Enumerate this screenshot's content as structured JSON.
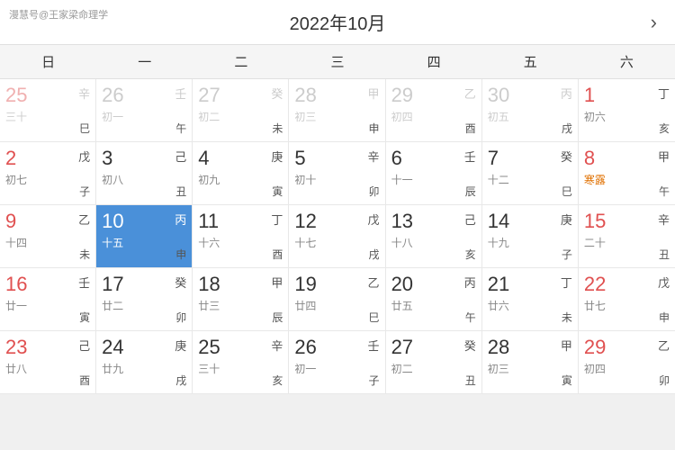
{
  "header": {
    "title": "2022年10月",
    "nav_next": "›",
    "watermark": "漫慧号@王家梁命理学"
  },
  "weekdays": [
    "日",
    "一",
    "二",
    "三",
    "四",
    "五",
    "六"
  ],
  "weeks": [
    [
      {
        "day": "25",
        "lunar": "三十",
        "heavenly": "辛",
        "earthly": "巳",
        "otherMonth": true,
        "weekend": true
      },
      {
        "day": "26",
        "lunar": "初一",
        "heavenly": "壬",
        "earthly": "午",
        "otherMonth": true,
        "weekend": false
      },
      {
        "day": "27",
        "lunar": "初二",
        "heavenly": "癸",
        "earthly": "未",
        "otherMonth": true,
        "weekend": false
      },
      {
        "day": "28",
        "lunar": "初三",
        "heavenly": "甲",
        "earthly": "申",
        "otherMonth": true,
        "weekend": false
      },
      {
        "day": "29",
        "lunar": "初四",
        "heavenly": "乙",
        "earthly": "酉",
        "otherMonth": true,
        "weekend": false
      },
      {
        "day": "30",
        "lunar": "初五",
        "heavenly": "丙",
        "earthly": "戌",
        "otherMonth": true,
        "weekend": false
      },
      {
        "day": "1",
        "lunar": "初六",
        "heavenly": "丁",
        "earthly": "亥",
        "otherMonth": false,
        "weekend": true
      }
    ],
    [
      {
        "day": "2",
        "lunar": "初七",
        "heavenly": "戊",
        "earthly": "子",
        "otherMonth": false,
        "weekend": true
      },
      {
        "day": "3",
        "lunar": "初八",
        "heavenly": "己",
        "earthly": "丑",
        "otherMonth": false,
        "weekend": false
      },
      {
        "day": "4",
        "lunar": "初九",
        "heavenly": "庚",
        "earthly": "寅",
        "otherMonth": false,
        "weekend": false
      },
      {
        "day": "5",
        "lunar": "初十",
        "heavenly": "辛",
        "earthly": "卯",
        "otherMonth": false,
        "weekend": false
      },
      {
        "day": "6",
        "lunar": "十一",
        "heavenly": "壬",
        "earthly": "辰",
        "otherMonth": false,
        "weekend": false
      },
      {
        "day": "7",
        "lunar": "十二",
        "heavenly": "癸",
        "earthly": "巳",
        "otherMonth": false,
        "weekend": false
      },
      {
        "day": "8",
        "lunar": "寒露",
        "heavenly": "甲",
        "earthly": "午",
        "otherMonth": false,
        "weekend": true,
        "solarTerm": "寒露"
      }
    ],
    [
      {
        "day": "9",
        "lunar": "十四",
        "heavenly": "乙",
        "earthly": "未",
        "otherMonth": false,
        "weekend": true
      },
      {
        "day": "10",
        "lunar": "十五",
        "heavenly": "丙",
        "earthly": "申",
        "otherMonth": false,
        "weekend": false,
        "today": true
      },
      {
        "day": "11",
        "lunar": "十六",
        "heavenly": "丁",
        "earthly": "酉",
        "otherMonth": false,
        "weekend": false
      },
      {
        "day": "12",
        "lunar": "十七",
        "heavenly": "戊",
        "earthly": "戌",
        "otherMonth": false,
        "weekend": false
      },
      {
        "day": "13",
        "lunar": "十八",
        "heavenly": "己",
        "earthly": "亥",
        "otherMonth": false,
        "weekend": false
      },
      {
        "day": "14",
        "lunar": "十九",
        "heavenly": "庚",
        "earthly": "子",
        "otherMonth": false,
        "weekend": false
      },
      {
        "day": "15",
        "lunar": "二十",
        "heavenly": "辛",
        "earthly": "丑",
        "otherMonth": false,
        "weekend": true
      }
    ],
    [
      {
        "day": "16",
        "lunar": "廿一",
        "heavenly": "壬",
        "earthly": "寅",
        "otherMonth": false,
        "weekend": true
      },
      {
        "day": "17",
        "lunar": "廿二",
        "heavenly": "癸",
        "earthly": "卯",
        "otherMonth": false,
        "weekend": false
      },
      {
        "day": "18",
        "lunar": "廿三",
        "heavenly": "甲",
        "earthly": "辰",
        "otherMonth": false,
        "weekend": false
      },
      {
        "day": "19",
        "lunar": "廿四",
        "heavenly": "乙",
        "earthly": "巳",
        "otherMonth": false,
        "weekend": false
      },
      {
        "day": "20",
        "lunar": "廿五",
        "heavenly": "丙",
        "earthly": "午",
        "otherMonth": false,
        "weekend": false
      },
      {
        "day": "21",
        "lunar": "廿六",
        "heavenly": "丁",
        "earthly": "未",
        "otherMonth": false,
        "weekend": false
      },
      {
        "day": "22",
        "lunar": "廿七",
        "heavenly": "戊",
        "earthly": "申",
        "otherMonth": false,
        "weekend": true
      }
    ],
    [
      {
        "day": "23",
        "lunar": "廿八",
        "heavenly": "己",
        "earthly": "酉",
        "otherMonth": false,
        "weekend": true
      },
      {
        "day": "24",
        "lunar": "廿九",
        "heavenly": "庚",
        "earthly": "戌",
        "otherMonth": false,
        "weekend": false
      },
      {
        "day": "25",
        "lunar": "三十",
        "heavenly": "辛",
        "earthly": "亥",
        "otherMonth": false,
        "weekend": false
      },
      {
        "day": "26",
        "lunar": "初一",
        "heavenly": "壬",
        "earthly": "子",
        "otherMonth": false,
        "weekend": false
      },
      {
        "day": "27",
        "lunar": "初二",
        "heavenly": "癸",
        "earthly": "丑",
        "otherMonth": false,
        "weekend": false
      },
      {
        "day": "28",
        "lunar": "初三",
        "heavenly": "甲",
        "earthly": "寅",
        "otherMonth": false,
        "weekend": false
      },
      {
        "day": "29",
        "lunar": "初四",
        "heavenly": "乙",
        "earthly": "卯",
        "otherMonth": false,
        "weekend": true
      }
    ]
  ]
}
